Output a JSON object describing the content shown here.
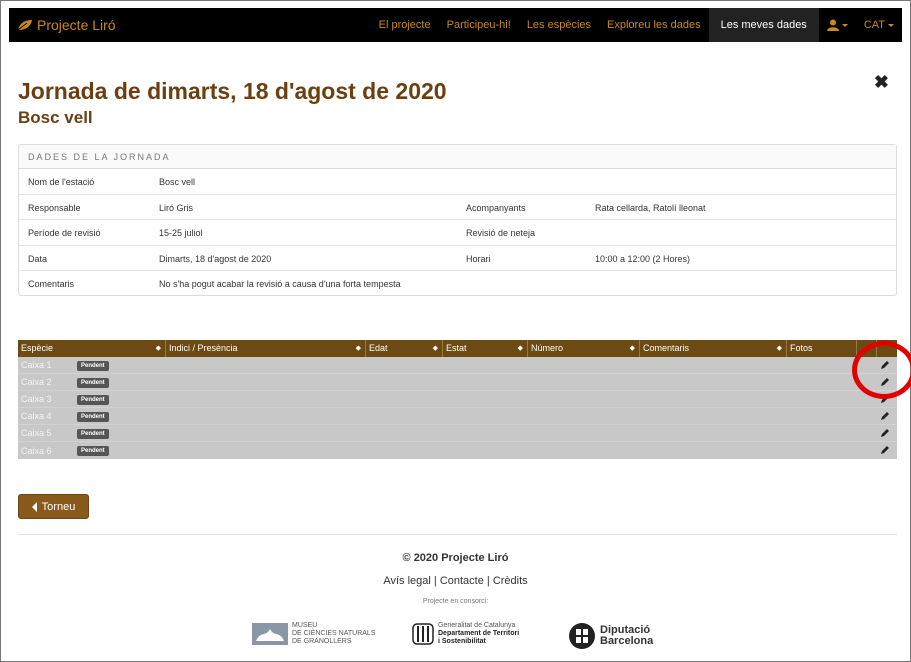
{
  "navbar": {
    "brand": "Projecte Liró",
    "items": [
      "El projecte",
      "Participeu-hi!",
      "Les espècies",
      "Exploreu les dades",
      "Les meves dades"
    ],
    "user_icon": "user-icon",
    "language": "CAT"
  },
  "header": {
    "title": "Jornada de dimarts, 18 d'agost de 2020",
    "subtitle": "Bosc vell",
    "close_icon": "close-icon"
  },
  "details": {
    "heading": "DADES DE LA JORNADA",
    "rows": [
      {
        "label": "Nom de l'estació",
        "value": "Bosc vell",
        "label2": "",
        "value2": ""
      },
      {
        "label": "Responsable",
        "value": "Liró Gris",
        "label2": "Acompanyants",
        "value2": "Rata cellarda, Ratolí lleonat"
      },
      {
        "label": "Període de revisió",
        "value": "15-25 juliol",
        "label2": "Revisió de neteja",
        "value2": ""
      },
      {
        "label": "Data",
        "value": "Dimarts, 18 d'agost de 2020",
        "label2": "Horari",
        "value2": "10:00 a 12:00 (2 Hores)"
      },
      {
        "label": "Comentaris",
        "value": "No s'ha pogut acabar la revisió a causa d'una forta tempesta",
        "label2": "",
        "value2": ""
      }
    ]
  },
  "table": {
    "columns": [
      "Espècie",
      "Indici / Presència",
      "Edat",
      "Estat",
      "Número",
      "Comentaris",
      "Fotos"
    ],
    "sort_glyph": "◆",
    "rows": [
      {
        "caixa": "Caixa 1",
        "badge": "Pendent"
      },
      {
        "caixa": "Caixa 2",
        "badge": "Pendent"
      },
      {
        "caixa": "Caixa 3",
        "badge": "Pendent"
      },
      {
        "caixa": "Caixa 4",
        "badge": "Pendent"
      },
      {
        "caixa": "Caixa 5",
        "badge": "Pendent"
      },
      {
        "caixa": "Caixa 6",
        "badge": "Pendent"
      }
    ],
    "edit_icon": "pencil-icon"
  },
  "back_button": "Torneu",
  "footer": {
    "copyright": "© 2020 Projecte Liró",
    "links": [
      "Avís legal",
      "Contacte",
      "Crèdits"
    ],
    "consorci": "Projecte en consorci:",
    "logos": [
      {
        "lines": [
          "MUSEU",
          "DE CIÈNCIES NATURALS",
          "DE GRANOLLERS"
        ]
      },
      {
        "lines": [
          "Generalitat de Catalunya",
          "Departament de Territori",
          "i Sostenibilitat"
        ]
      },
      {
        "lines": [
          "Diputació",
          "Barcelona"
        ]
      }
    ]
  },
  "colors": {
    "accent": "#c98a1a",
    "title": "#6b3f10",
    "table_header": "#6b4a14",
    "button": "#8a5a1c",
    "annotation": "#e00000"
  }
}
